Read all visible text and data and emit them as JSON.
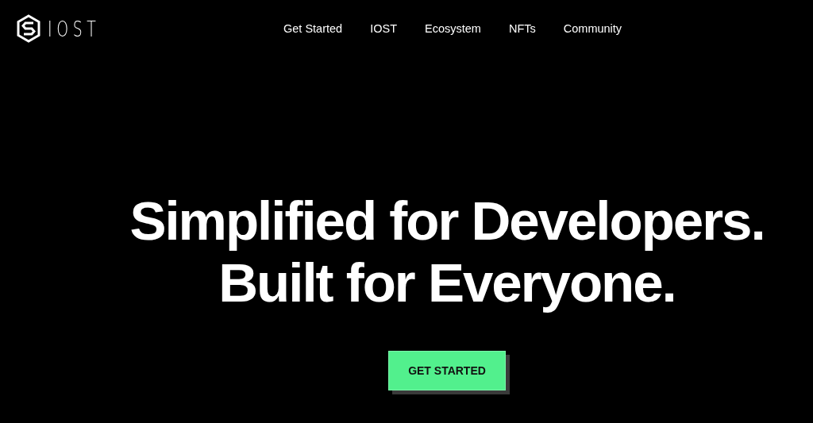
{
  "logo": {
    "text": "IOST"
  },
  "nav": [
    "Get Started",
    "IOST",
    "Ecosystem",
    "NFTs",
    "Community"
  ],
  "hero": {
    "lines": [
      "Simplified for Developers.",
      "Built for Everyone."
    ],
    "button": "GET STARTED"
  }
}
